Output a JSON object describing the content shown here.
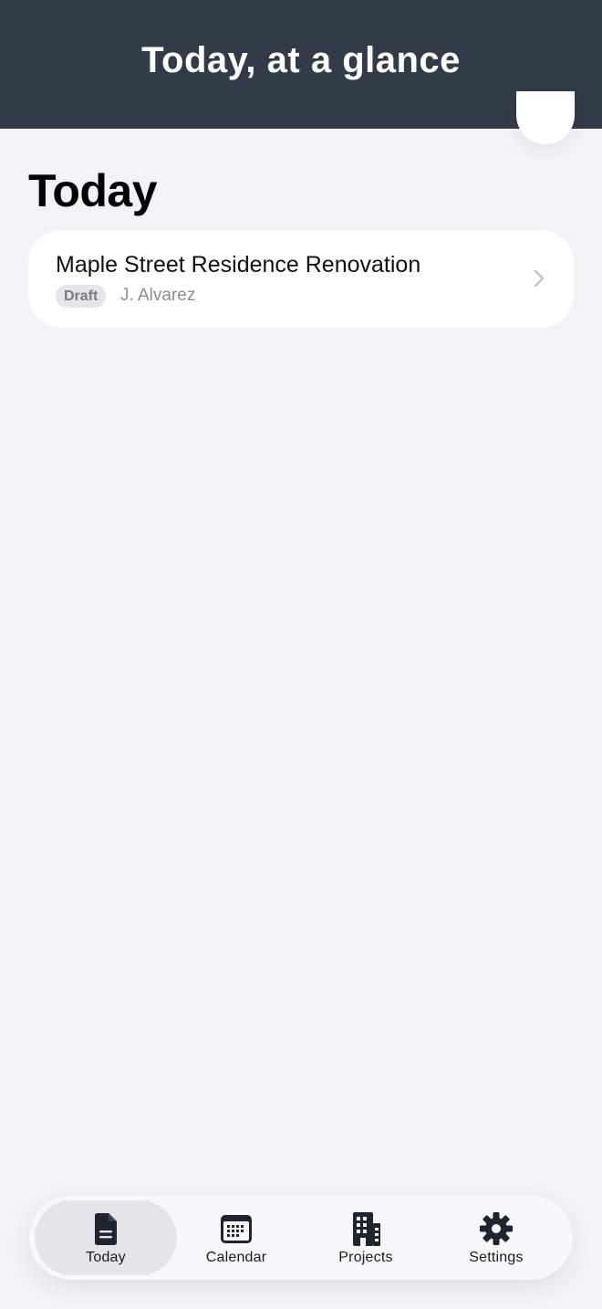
{
  "header": {
    "title": "Today, at a glance"
  },
  "section": {
    "title": "Today"
  },
  "items": [
    {
      "title": "Maple Street Residence Renovation",
      "status": "Draft",
      "author": "J. Alvarez"
    }
  ],
  "tabs": [
    {
      "label": "Today",
      "icon": "document-icon",
      "active": true
    },
    {
      "label": "Calendar",
      "icon": "calendar-icon",
      "active": false
    },
    {
      "label": "Projects",
      "icon": "building-icon",
      "active": false
    },
    {
      "label": "Settings",
      "icon": "gear-icon",
      "active": false
    }
  ],
  "colors": {
    "header_bg": "#323b48",
    "page_bg": "#f2f2f7",
    "card_bg": "#ffffff",
    "badge_bg": "#e5e5ea",
    "active_tab_bg": "#e4e4ea",
    "icon": "#1f2530"
  }
}
